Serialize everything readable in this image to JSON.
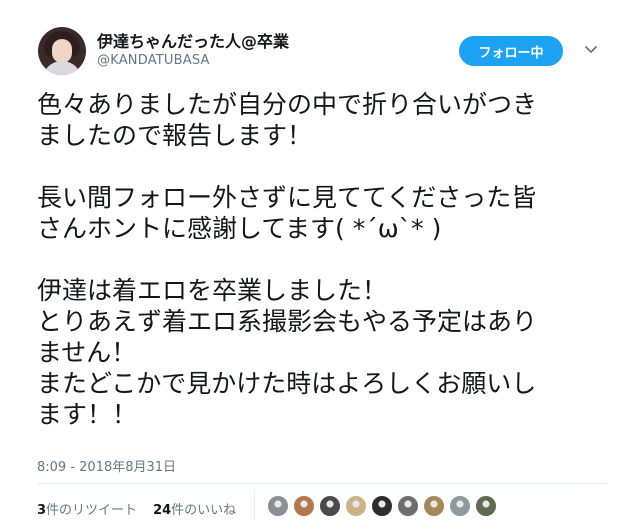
{
  "user": {
    "display_name": "伊達ちゃんだった人@卒業",
    "handle": "@KANDATUBASA"
  },
  "follow_button": {
    "label": "フォロー中"
  },
  "tweet": {
    "lines": [
      "色々ありましたが自分の中で折り合いがつき",
      "ましたので報告します！",
      "",
      "長い間フォロー外さずに見ててくださった皆",
      "さんホントに感謝してます( *´ω`* )",
      "",
      "伊達は着エロを卒業しました！",
      "とりあえず着エロ系撮影会もやる予定はあり",
      "ません！",
      "またどこかで見かけた時はよろしくお願いし",
      "ます！！"
    ],
    "timestamp": "8:09 - 2018年8月31日"
  },
  "stats": {
    "retweet_count": "3",
    "retweet_label": "件のリツイート",
    "like_count": "24",
    "like_label": "件のいいね"
  },
  "likers": [
    {
      "name": "liker-1",
      "color": "#8a8f96"
    },
    {
      "name": "liker-2",
      "color": "#b3774f"
    },
    {
      "name": "liker-3",
      "color": "#4a4a4a"
    },
    {
      "name": "liker-4",
      "color": "#c9b48a"
    },
    {
      "name": "liker-5",
      "color": "#2d2d2d"
    },
    {
      "name": "liker-6",
      "color": "#6e6e6e"
    },
    {
      "name": "liker-7",
      "color": "#a48a5a"
    },
    {
      "name": "liker-8",
      "color": "#8e9aa0"
    },
    {
      "name": "liker-9",
      "color": "#5f6a50"
    }
  ],
  "colors": {
    "accent": "#1da1f2",
    "secondary_text": "#657786",
    "primary_text": "#14171a"
  },
  "icons": {
    "caret": "chevron-down-icon"
  }
}
